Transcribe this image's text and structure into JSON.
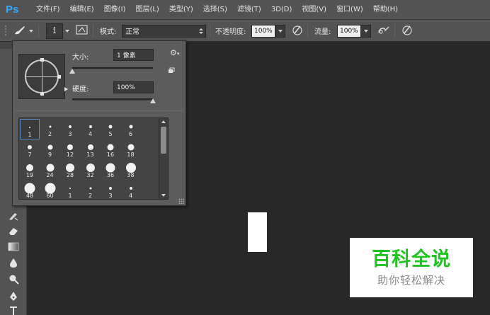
{
  "app": {
    "logo": "Ps"
  },
  "menu": [
    "文件(F)",
    "编辑(E)",
    "图像(I)",
    "图层(L)",
    "类型(Y)",
    "选择(S)",
    "滤镜(T)",
    "3D(D)",
    "视图(V)",
    "窗口(W)",
    "帮助(H)"
  ],
  "options_bar": {
    "brush_size_value": "1",
    "mode_label": "模式:",
    "mode_value": "正常",
    "opacity_label": "不透明度:",
    "opacity_value": "100%",
    "flow_label": "流量:",
    "flow_value": "100%"
  },
  "brush_popup": {
    "size_label": "大小:",
    "size_value": "1 像素",
    "size_slider_fraction": 0.0,
    "hardness_label": "硬度:",
    "hardness_value": "100%",
    "hardness_slider_fraction": 1.0,
    "presets": [
      "1",
      "2",
      "3",
      "4",
      "5",
      "6",
      "7",
      "9",
      "12",
      "13",
      "16",
      "18",
      "19",
      "24",
      "28",
      "32",
      "36",
      "38",
      "48",
      "60",
      "1",
      "2",
      "3",
      "4"
    ],
    "selected_preset_index": 0
  },
  "watermark": {
    "main_text": "百科全说",
    "sub_text": "助你轻松解决",
    "main_color": "#20c320"
  },
  "colors": {
    "panel_bg": "#535353",
    "canvas_bg": "#282828",
    "accent_blue": "#31a8ff"
  }
}
